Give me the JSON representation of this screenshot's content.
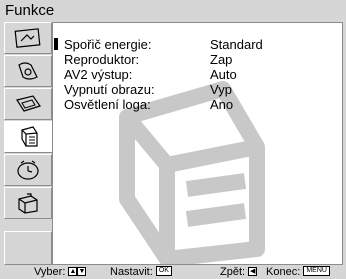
{
  "title": "Funkce",
  "sidebar": {
    "tabs": [
      {
        "icon": "picture-adjust-icon"
      },
      {
        "icon": "sound-adjust-icon"
      },
      {
        "icon": "screen-control-icon"
      },
      {
        "icon": "features-icon",
        "active": true
      },
      {
        "icon": "timer-icon"
      },
      {
        "icon": "setup-icon"
      },
      {
        "icon": "empty"
      }
    ]
  },
  "menu": {
    "rows": [
      {
        "label": "Spořič energie:",
        "value": "Standard",
        "selected": true
      },
      {
        "label": "Reproduktor:",
        "value": "Zap"
      },
      {
        "label": "AV2  výstup:",
        "value": "Auto"
      },
      {
        "label": "Vypnutí obrazu:",
        "value": "Vyp"
      },
      {
        "label": "Osvětlení loga:",
        "value": "Ano"
      }
    ]
  },
  "status_bar": {
    "select_label": "Vyber:",
    "set_label": "Nastavit:",
    "set_key": "OK",
    "back_label": "Zpět:",
    "exit_label": "Konec:",
    "exit_key": "MENU"
  },
  "colors": {
    "background": "#d6d6d6",
    "panel": "#ffffff",
    "border": "#8c8c8c",
    "watermark": "#c8c8c8"
  }
}
